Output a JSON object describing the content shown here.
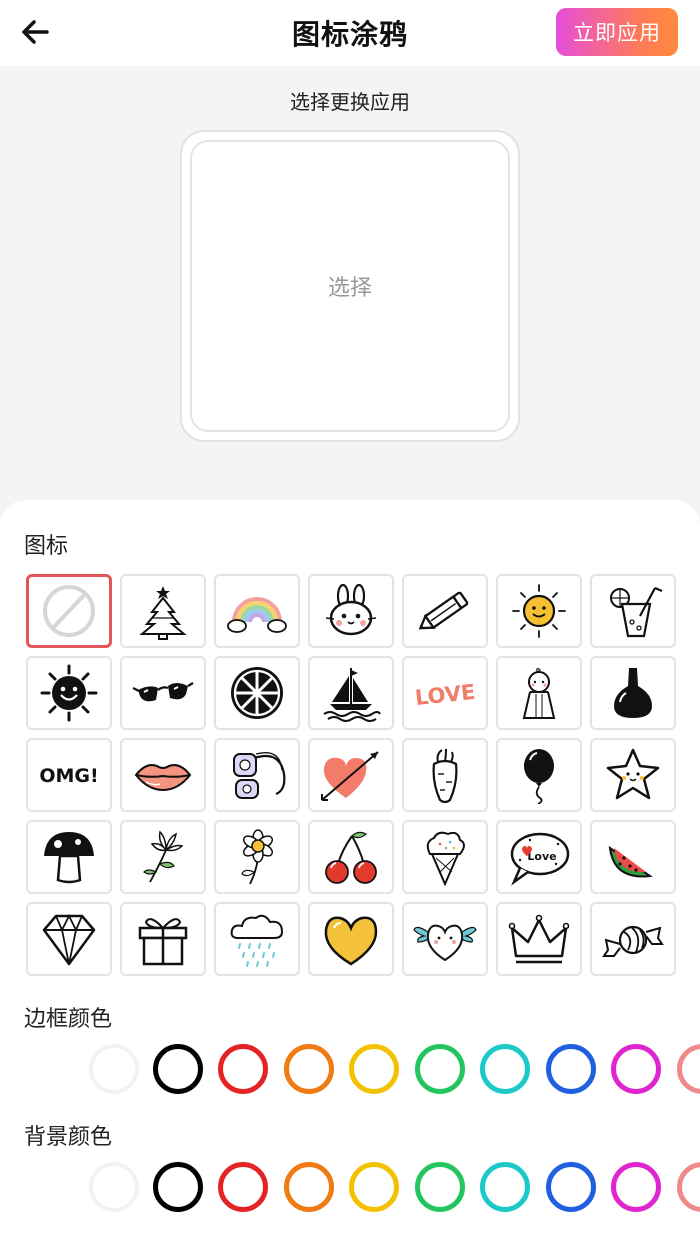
{
  "header": {
    "title": "图标涂鸦",
    "apply_label": "立即应用"
  },
  "preview": {
    "subtitle": "选择更换应用",
    "placeholder": "选择"
  },
  "icons_section": {
    "label": "图标",
    "items": [
      "none-icon",
      "christmas-tree-icon",
      "rainbow-icon",
      "bunny-icon",
      "pencil-icon",
      "sun-face-icon",
      "lemonade-icon",
      "black-sun-icon",
      "sunglasses-icon",
      "lemon-slice-icon",
      "sailboat-icon",
      "love-text-icon",
      "teru-teru-doll-icon",
      "nail-polish-icon",
      "omg-text-icon",
      "lips-icon",
      "headphones-icon",
      "heart-arrow-icon",
      "carrot-icon",
      "balloon-icon",
      "star-face-icon",
      "mushroom-icon",
      "flower-stem-icon",
      "daisy-icon",
      "cherries-icon",
      "ice-cream-icon",
      "love-speech-bubble-icon",
      "watermelon-icon",
      "diamond-icon",
      "gift-box-icon",
      "rain-cloud-icon",
      "yellow-heart-icon",
      "winged-heart-icon",
      "crown-icon",
      "candy-icon"
    ],
    "love_text": "LOVE",
    "omg_text": "OMG!",
    "bubble_text": "Love"
  },
  "border_color_section": {
    "label": "边框颜色",
    "colors": [
      "#f2f2f2",
      "#000000",
      "#e42424",
      "#f07a14",
      "#f2c200",
      "#22c55e",
      "#1cc9c9",
      "#1f5fe0",
      "#e024d0",
      "#f08a8a"
    ]
  },
  "background_color_section": {
    "label": "背景颜色",
    "colors": [
      "#f2f2f2",
      "#000000",
      "#e42424",
      "#f07a14",
      "#f2c200",
      "#22c55e",
      "#1cc9c9",
      "#1f5fe0",
      "#e024d0",
      "#f08a8a"
    ]
  }
}
